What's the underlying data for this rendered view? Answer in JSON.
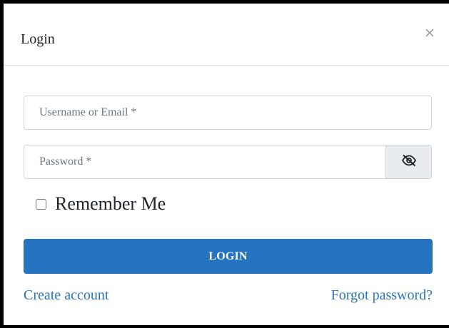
{
  "modal": {
    "title": "Login",
    "close_icon": "close-icon"
  },
  "form": {
    "username": {
      "placeholder": "Username or Email *",
      "value": ""
    },
    "password": {
      "placeholder": "Password *",
      "value": "",
      "toggle_icon": "eye-slash-icon"
    },
    "remember_label": "Remember Me",
    "remember_checked": false,
    "login_label": "LOGIN"
  },
  "links": {
    "create_account": "Create account",
    "forgot_password": "Forgot password?"
  },
  "colors": {
    "primary": "#2573c1",
    "link": "#2a73b9",
    "border": "#ced4da",
    "addon_bg": "#e9ecef"
  }
}
